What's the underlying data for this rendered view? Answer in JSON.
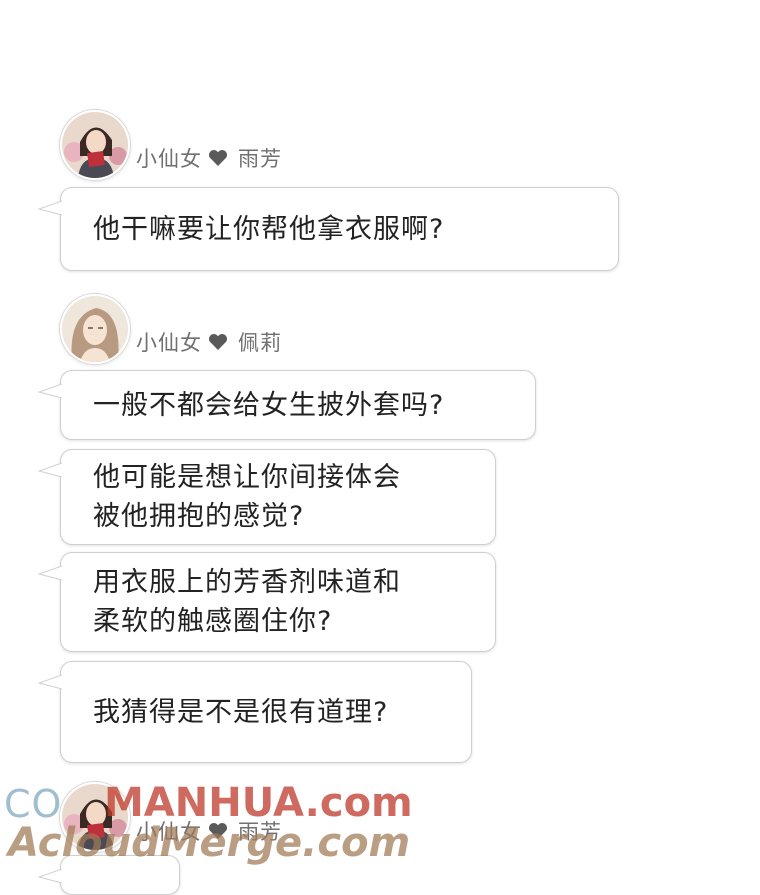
{
  "messages": [
    {
      "sender": "小仙女",
      "recipient": "雨芳",
      "avatar_icon": "woman-with-book-avatar-icon",
      "bubbles": [
        [
          "他干嘛要让你帮他拿衣服啊?"
        ]
      ]
    },
    {
      "sender": "小仙女",
      "recipient": "佩莉",
      "avatar_icon": "woman-long-hair-avatar-icon",
      "bubbles": [
        [
          "一般不都会给女生披外套吗?"
        ],
        [
          "他可能是想让你间接体会",
          "被他拥抱的感觉?"
        ],
        [
          "用衣服上的芳香剂味道和",
          "柔软的触感圈住你?"
        ],
        [
          "我猜得是不是很有道理?"
        ]
      ]
    },
    {
      "sender": "小仙女",
      "recipient": "雨芳",
      "avatar_icon": "woman-with-book-avatar-icon",
      "bubbles": []
    }
  ],
  "watermarks": {
    "line1_a": "CO",
    "line1_b": "MANHUA.com",
    "line2": "AcloudMerge.com"
  },
  "colors": {
    "name_text": "#707070",
    "heart": "#5a5a5a",
    "bubble_border": "#cfcfcf",
    "watermark_blue": "#8fb3c7",
    "watermark_red": "#c0392b",
    "watermark_brown": "#a07a55"
  }
}
